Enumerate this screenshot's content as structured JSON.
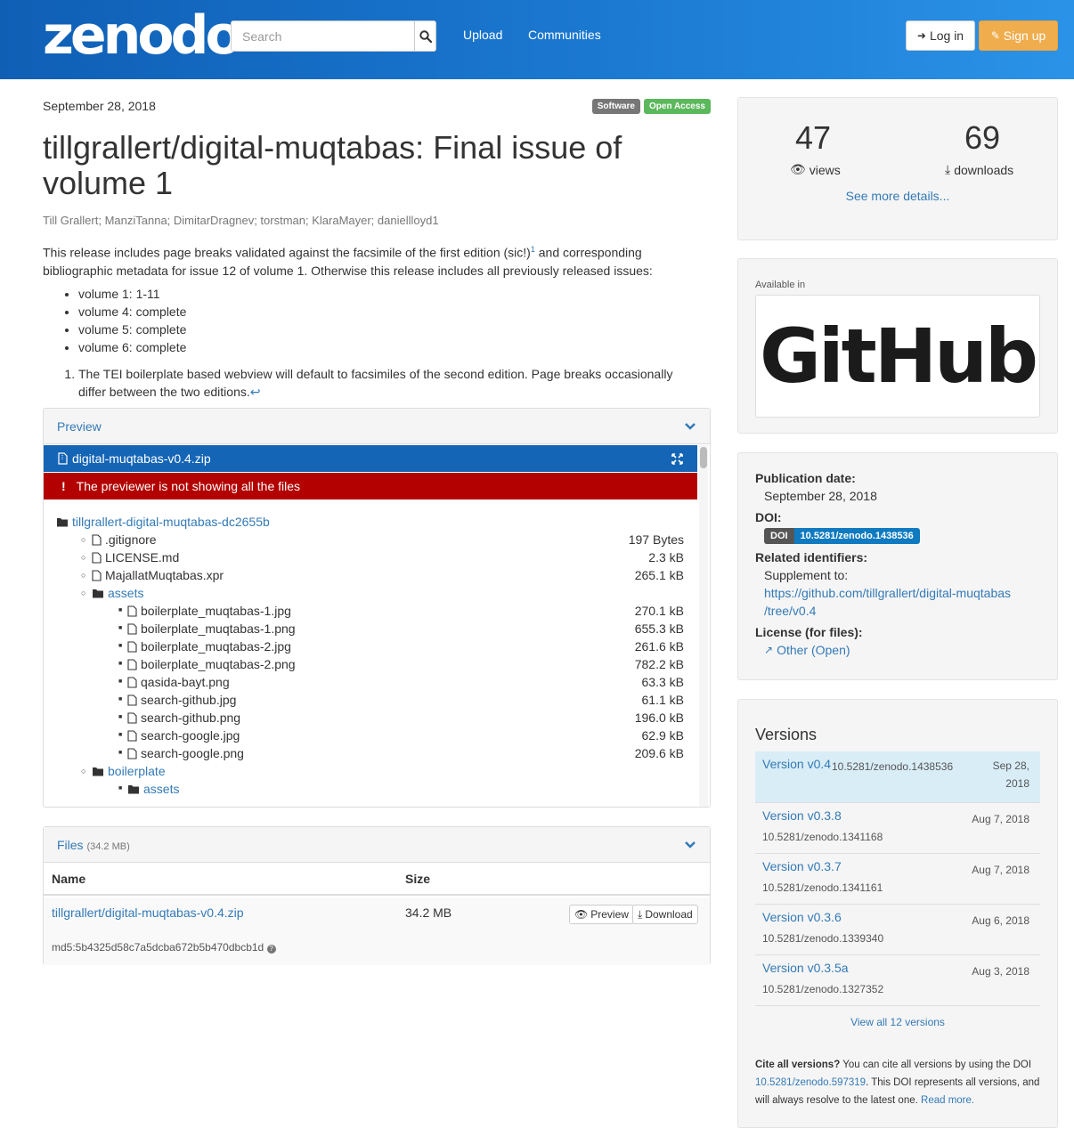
{
  "header": {
    "logo": "zenodo",
    "search_placeholder": "Search",
    "nav": [
      "Upload",
      "Communities"
    ],
    "login": "Log in",
    "signup": "Sign up",
    "colors": {
      "bar": "#1b78d0",
      "signup": "#f0ad4e"
    }
  },
  "record": {
    "date": "September 28, 2018",
    "badges": [
      "Software",
      "Open Access"
    ],
    "title": "tillgrallert/digital-muqtabas: Final issue of volume 1",
    "authors": "Till Grallert; ManziTanna; DimitarDragnev; torstman; KlaraMayer; daniellloyd1",
    "desc_part1": "This release includes page breaks validated against the facsimile of the first edition (sic!)",
    "desc_sup": "1",
    "desc_part2": " and corresponding bibliographic metadata for issue 12 of volume 1. Otherwise this release includes all previously released issues:",
    "bullets": [
      "volume 1: 1-11",
      "volume 4: complete",
      "volume 5: complete",
      "volume 6: complete"
    ],
    "footnote": "The TEI boilerplate based webview will default to facsimiles of the second edition. Page breaks occasionally differ between the two editions.",
    "footnote_back": "↩"
  },
  "preview": {
    "heading": "Preview",
    "file": "digital-muqtabas-v0.4.zip",
    "warning": "The previewer is not showing all the files",
    "tree": [
      {
        "name": "tillgrallert-digital-muqtabas-dc2655b",
        "type": "folder",
        "level": 0,
        "size": ""
      },
      {
        "name": ".gitignore",
        "type": "file",
        "level": 1,
        "size": "197 Bytes"
      },
      {
        "name": "LICENSE.md",
        "type": "file",
        "level": 1,
        "size": "2.3 kB"
      },
      {
        "name": "MajallatMuqtabas.xpr",
        "type": "file",
        "level": 1,
        "size": "265.1 kB"
      },
      {
        "name": "assets",
        "type": "folder",
        "level": 1,
        "size": ""
      },
      {
        "name": "boilerplate_muqtabas-1.jpg",
        "type": "file",
        "level": 2,
        "size": "270.1 kB"
      },
      {
        "name": "boilerplate_muqtabas-1.png",
        "type": "file",
        "level": 2,
        "size": "655.3 kB"
      },
      {
        "name": "boilerplate_muqtabas-2.jpg",
        "type": "file",
        "level": 2,
        "size": "261.6 kB"
      },
      {
        "name": "boilerplate_muqtabas-2.png",
        "type": "file",
        "level": 2,
        "size": "782.2 kB"
      },
      {
        "name": "qasida-bayt.png",
        "type": "file",
        "level": 2,
        "size": "63.3 kB"
      },
      {
        "name": "search-github.jpg",
        "type": "file",
        "level": 2,
        "size": "61.1 kB"
      },
      {
        "name": "search-github.png",
        "type": "file",
        "level": 2,
        "size": "196.0 kB"
      },
      {
        "name": "search-google.jpg",
        "type": "file",
        "level": 2,
        "size": "62.9 kB"
      },
      {
        "name": "search-google.png",
        "type": "file",
        "level": 2,
        "size": "209.6 kB"
      },
      {
        "name": "boilerplate",
        "type": "folder",
        "level": 1,
        "size": ""
      },
      {
        "name": "assets",
        "type": "folder",
        "level": 2,
        "size": ""
      }
    ]
  },
  "files": {
    "heading": "Files",
    "total": "(34.2 MB)",
    "col_name": "Name",
    "col_size": "Size",
    "file_name": "tillgrallert/digital-muqtabas-v0.4.zip",
    "file_size": "34.2 MB",
    "preview_btn": "Preview",
    "download_btn": "Download",
    "md5": "md5:5b4325d58c7a5dcba672b5b470dbcb1d"
  },
  "stats": {
    "views": "47",
    "views_label": "views",
    "downloads": "69",
    "downloads_label": "downloads",
    "more": "See more details..."
  },
  "available": {
    "label": "Available in",
    "logo_text": "GitHub"
  },
  "meta": {
    "pub_label": "Publication date:",
    "pub_date": "September 28, 2018",
    "doi_label": "DOI:",
    "doi_key": "DOI",
    "doi_value": "10.5281/zenodo.1438536",
    "related_label": "Related identifiers:",
    "supplement": "Supplement to:",
    "related_url_1": "https://github.com/tillgrallert/digital-muqtabas",
    "related_url_2": "/tree/v0.4",
    "license_label": "License (for files):",
    "license_value": "Other (Open)"
  },
  "versions": {
    "title": "Versions",
    "items": [
      {
        "label": "Version v0.4",
        "doi": "10.5281/zenodo.1438536",
        "date1": "Sep 28,",
        "date2": "2018"
      },
      {
        "label": "Version v0.3.8",
        "doi": "10.5281/zenodo.1341168",
        "date1": "Aug 7, 2018",
        "date2": ""
      },
      {
        "label": "Version v0.3.7",
        "doi": "10.5281/zenodo.1341161",
        "date1": "Aug 7, 2018",
        "date2": ""
      },
      {
        "label": "Version v0.3.6",
        "doi": "10.5281/zenodo.1339340",
        "date1": "Aug 6, 2018",
        "date2": ""
      },
      {
        "label": "Version v0.3.5a",
        "doi": "10.5281/zenodo.1327352",
        "date1": "Aug 3, 2018",
        "date2": ""
      }
    ],
    "view_all": "View all 12 versions",
    "cite_bold": "Cite all versions?",
    "cite_text1": " You can cite all versions by using the DOI ",
    "cite_doi": "10.5281/zenodo.597319",
    "cite_text2": ". This DOI represents all versions, and will always resolve to the latest one. ",
    "read_more": "Read more."
  }
}
